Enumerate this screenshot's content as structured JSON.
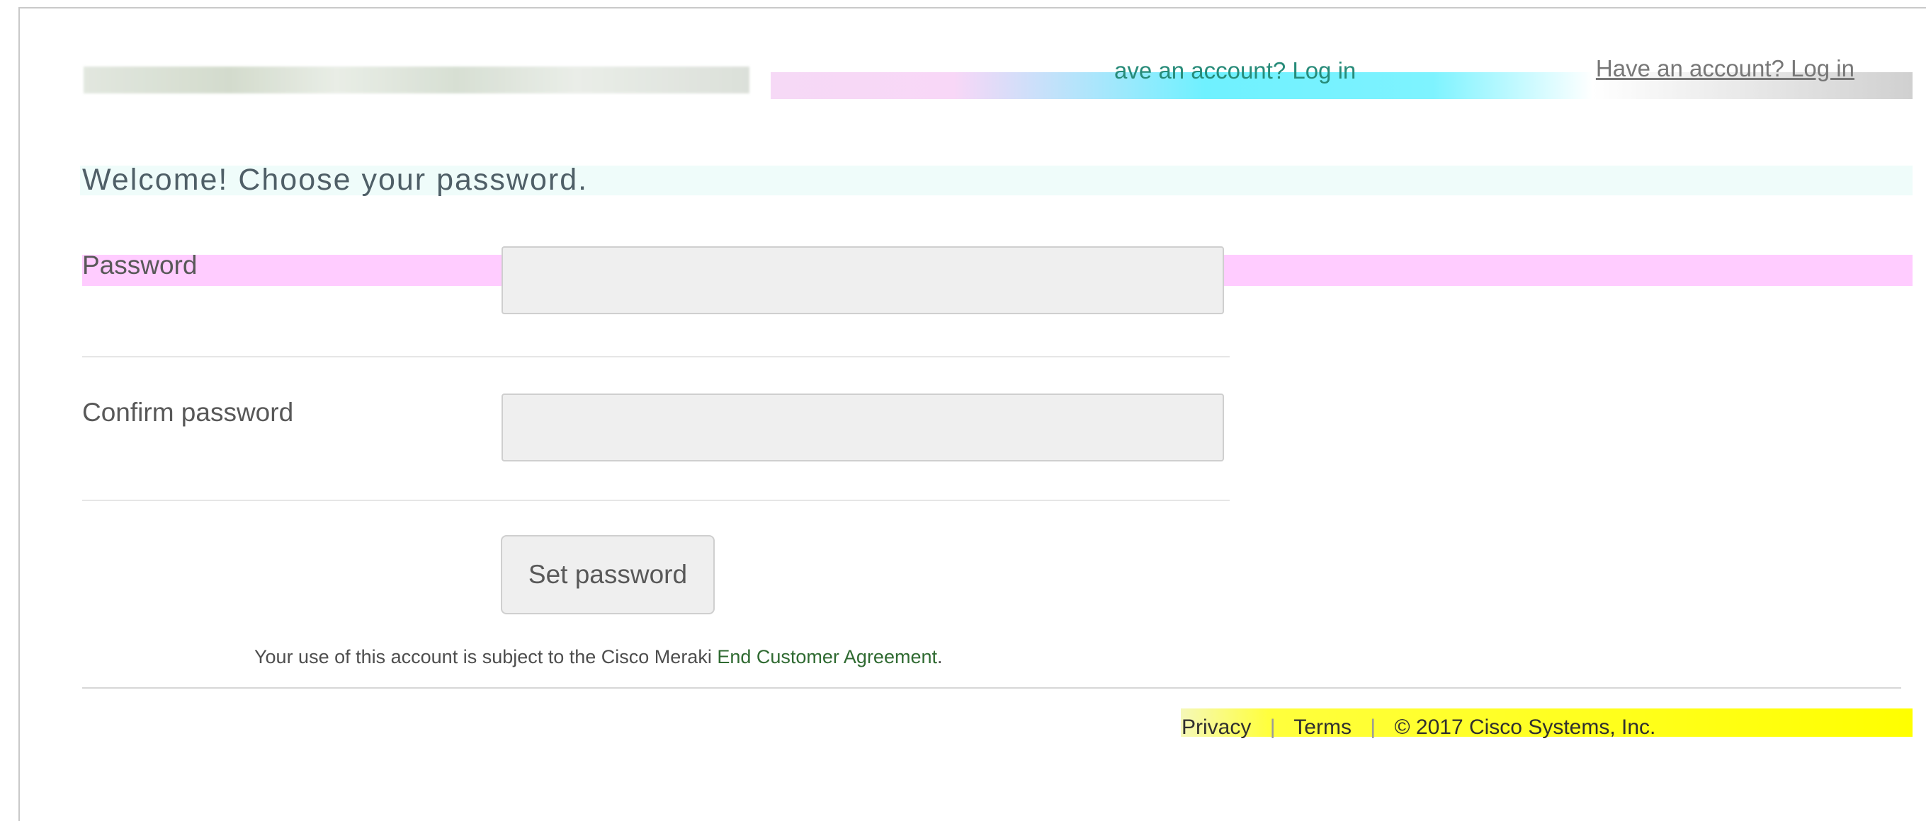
{
  "header": {
    "link_text": "Have an account? Log in",
    "ghost_link_text": "ave an account? Log in"
  },
  "form": {
    "title": "Welcome! Choose your password.",
    "fields": [
      {
        "label": "Password",
        "value": "",
        "placeholder": ""
      },
      {
        "label": "Confirm password",
        "value": "",
        "placeholder": ""
      }
    ],
    "submit_label": "Set password"
  },
  "legal": {
    "prefix": "Your use of this account is subject to the Cisco Meraki ",
    "link_text": "End Customer Agreement",
    "suffix": "."
  },
  "footer": {
    "privacy": "Privacy",
    "terms": "Terms",
    "copyright": "© 2017 Cisco Systems, Inc."
  },
  "colors": {
    "link": "#2f6a31",
    "input_background": "#efefef",
    "highlight_pink": "#ffccff",
    "highlight_yellow": "#ffff00",
    "highlight_cyan": "#7ef3ff"
  }
}
